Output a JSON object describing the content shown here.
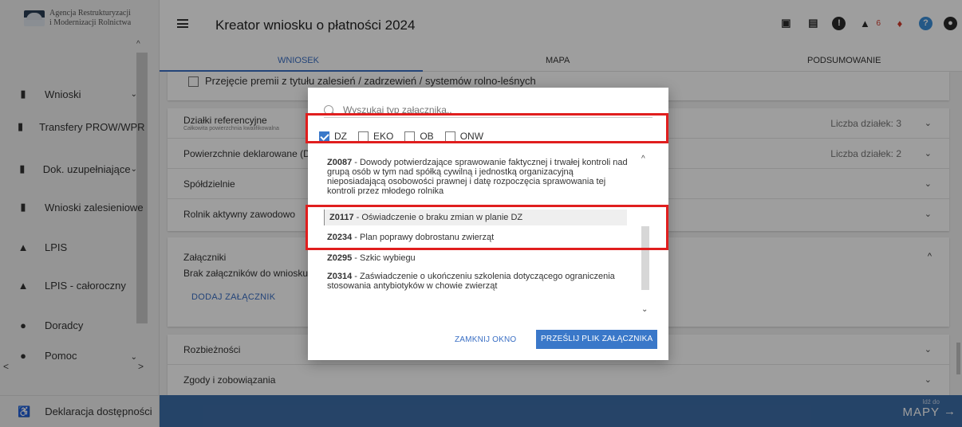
{
  "brand": {
    "line1": "Agencja Restrukturyzacji",
    "line2": "i Modernizacji Rolnictwa"
  },
  "sidebar": {
    "items": [
      {
        "label": "Wnioski",
        "icon": "clipboard-icon",
        "chevron": "⌄"
      },
      {
        "label": "Transfery PROW/WPR",
        "icon": "clipboard-icon",
        "chevron": ""
      },
      {
        "label": "Dok. uzupełniające",
        "icon": "clipboard-icon",
        "chevron": "⌄"
      },
      {
        "label": "Wnioski zalesieniowe",
        "icon": "clipboard-icon",
        "chevron": ""
      },
      {
        "label": "LPIS",
        "icon": "mountains-icon",
        "chevron": ""
      },
      {
        "label": "LPIS - całoroczny",
        "icon": "mountains-icon",
        "chevron": ""
      },
      {
        "label": "Doradcy",
        "icon": "person-icon",
        "chevron": ""
      },
      {
        "label": "Pomoc",
        "icon": "help-icon",
        "chevron": "⌄"
      }
    ],
    "footer_label": "Deklaracja dostępności"
  },
  "header": {
    "title": "Kreator wniosku o płatności 2024",
    "warning_count": "6"
  },
  "tabs": [
    "WNIOSEK",
    "MAPA",
    "PODSUMOWANIE"
  ],
  "content": {
    "top_checkbox_label": "Przejęcie premii z tytułu zalesień / zadrzewień / systemów rolno-leśnych",
    "rows": [
      {
        "title": "Działki referencyjne",
        "subtitle": "Całkowita powierzchnia kwalifikowalna",
        "right": "Liczba działek: 3"
      },
      {
        "title": "Powierzchnie deklarowane (Dz",
        "subtitle": "",
        "right": "Liczba działek: 2"
      },
      {
        "title": "Spółdzielnie",
        "subtitle": "",
        "right": ""
      },
      {
        "title": "Rolnik aktywny zawodowo",
        "subtitle": "",
        "right": ""
      }
    ],
    "attachments_title": "Załączniki",
    "attachments_empty": "Brak załączników do wniosku",
    "add_attachment": "DODAJ ZAŁĄCZNIK",
    "bottom_rows": [
      "Rozbieżności",
      "Zgody i zobowiązania"
    ]
  },
  "footer": {
    "small": "Idź do",
    "big": "MAPY"
  },
  "modal": {
    "search_placeholder": "Wyszukaj typ załącznika..",
    "filters": [
      {
        "label": "DZ",
        "checked": true
      },
      {
        "label": "EKO",
        "checked": false
      },
      {
        "label": "OB",
        "checked": false
      },
      {
        "label": "ONW",
        "checked": false
      }
    ],
    "list": [
      {
        "code": "Z0087",
        "text": " - Dowody potwierdzające sprawowanie faktycznej i trwałej kontroli nad grupą osób w tym nad spółką cywilną i jednostką organizacyjną nieposiadającą osobowości prawnej i datę rozpoczęcia sprawowania tej kontroli przez młodego rolnika"
      },
      {
        "code": "Z0117",
        "text": " - Oświadczenie o braku zmian w planie DZ"
      },
      {
        "code": "Z0234",
        "text": " - Plan poprawy dobrostanu zwierząt"
      },
      {
        "code": "Z0295",
        "text": " - Szkic wybiegu"
      },
      {
        "code": "Z0314",
        "text": " - Zaświadczenie o ukończeniu szkolenia dotyczącego ograniczenia stosowania antybiotyków w chowie zwierząt"
      }
    ],
    "close_label": "ZAMKNIJ OKNO",
    "send_label": "PRZEŚLIJ PLIK ZAŁĄCZNIKA"
  },
  "colors": {
    "accent": "#3a78c9",
    "annotation": "#e01e1e",
    "footer": "#3d6ea8"
  }
}
